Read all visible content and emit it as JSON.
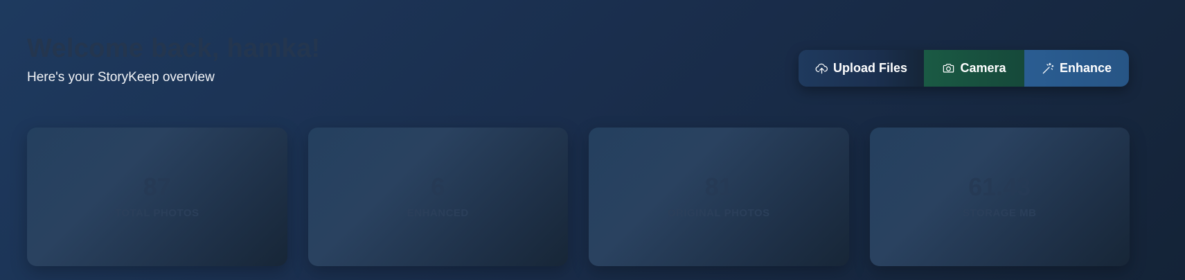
{
  "header": {
    "title": "Welcome back, hamka!",
    "subtitle": "Here's your StoryKeep overview"
  },
  "actions": {
    "upload": {
      "label": "Upload Files",
      "icon": "cloud-upload-icon"
    },
    "camera": {
      "label": "Camera",
      "icon": "camera-icon"
    },
    "enhance": {
      "label": "Enhance",
      "icon": "magic-wand-icon"
    }
  },
  "stats": [
    {
      "value": "87",
      "label": "TOTAL PHOTOS"
    },
    {
      "value": "6",
      "label": "ENHANCED"
    },
    {
      "value": "81",
      "label": "ORIGINAL PHOTOS"
    },
    {
      "value": "61.43",
      "label": "STORAGE MB"
    }
  ],
  "colors": {
    "background": "#1a2e4d",
    "upload_button": "#1f3a5e",
    "camera_button": "#1a5a44",
    "enhance_button": "#2a5d92",
    "subtitle_text": "#f3f5f8"
  }
}
